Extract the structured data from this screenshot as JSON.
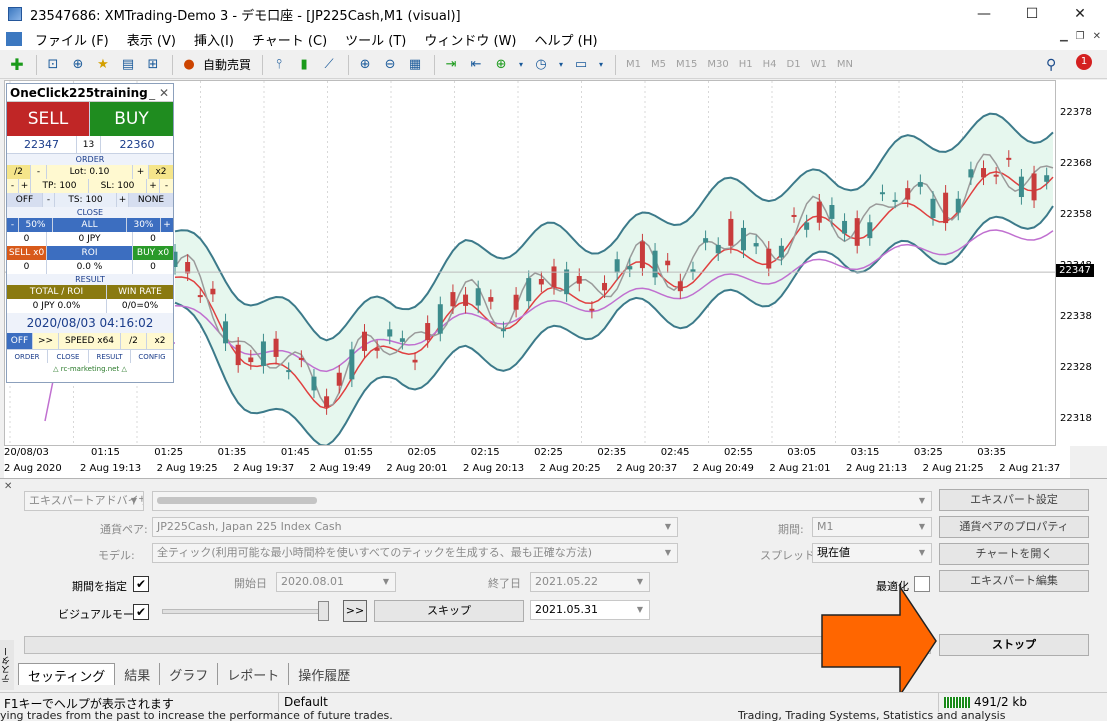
{
  "window": {
    "title": "23547686: XMTrading-Demo 3 - デモ口座 - [JP225Cash,M1 (visual)]",
    "minimize": "—",
    "maximize": "☐",
    "close": "✕"
  },
  "menu": [
    "ファイル (F)",
    "表示 (V)",
    "挿入(I)",
    "チャート (C)",
    "ツール (T)",
    "ウィンドウ (W)",
    "ヘルプ (H)"
  ],
  "toolbar": {
    "auto_trade": "自動売買",
    "timeframes": [
      "M1",
      "M5",
      "M15",
      "M30",
      "H1",
      "H4",
      "D1",
      "W1",
      "MN"
    ],
    "notification_count": "1"
  },
  "chart": {
    "price_labels": [
      "22378",
      "22368",
      "22358",
      "22348",
      "22338",
      "22328",
      "22318"
    ],
    "current_price": "22347",
    "time_labels_top": [
      "20/08/03",
      "01:15",
      "01:25",
      "01:35",
      "01:45",
      "01:55",
      "02:05",
      "02:15",
      "02:25",
      "02:35",
      "02:45",
      "02:55",
      "03:05",
      "03:15",
      "03:25",
      "03:35"
    ],
    "time_labels_bottom": [
      "2 Aug 2020",
      "2 Aug 19:13",
      "2 Aug 19:25",
      "2 Aug 19:37",
      "2 Aug 19:49",
      "2 Aug 20:01",
      "2 Aug 20:13",
      "2 Aug 20:25",
      "2 Aug 20:37",
      "2 Aug 20:49",
      "2 Aug 21:01",
      "2 Aug 21:13",
      "2 Aug 21:25",
      "2 Aug 21:37"
    ],
    "colors": {
      "bull": "#3d8c8c",
      "bear": "#c83c3c",
      "band": "#3c7a8a",
      "ma_fast": "#e04040",
      "ma_slow": "#c070d0",
      "ma_grey": "#9a9a9a"
    }
  },
  "panel": {
    "title": "OneClick225training",
    "sell": "SELL",
    "buy": "BUY",
    "bid": "22347",
    "spread": "13",
    "ask": "22360",
    "order_label": "ORDER",
    "div2": "/2",
    "lot": "Lot: 0.10",
    "plus": "+",
    "x2": "x2",
    "minus": "-",
    "tp": "TP: 100",
    "sl": "SL: 100",
    "off": "OFF",
    "ts": "TS: 100",
    "none": "NONE",
    "close_label": "CLOSE",
    "p50": "50%",
    "all": "ALL",
    "p30": "30%",
    "zero": "0",
    "zero_jpy": "0 JPY",
    "sell_x0": "SELL x0",
    "roi": "ROI",
    "buy_x0": "BUY x0",
    "roi_val": "0.0 %",
    "result_label": "RESULT",
    "total_roi": "TOTAL / ROI",
    "win_rate": "WIN RATE",
    "total_val": "0 JPY 0.0%",
    "win_val": "0/0=0%",
    "datetime": "2020/08/03   04:16:02",
    "ctl_off": "OFF",
    "ctl_ff": ">>",
    "speed": "SPEED x64",
    "tabs": [
      "ORDER",
      "CLOSE",
      "RESULT",
      "CONFIG"
    ],
    "footer": "△ rc-marketing.net △"
  },
  "tester": {
    "expert_type": "エキスパートアドバイザ",
    "expert_name": "",
    "symbol_label": "通貨ペア:",
    "symbol": "JP225Cash, Japan 225 Index Cash",
    "model_label": "モデル:",
    "model": "全ティック(利用可能な最小時間枠を使いすべてのティックを生成する、最も正確な方法)",
    "period_label": "期間:",
    "period": "M1",
    "spread_label": "スプレッド:",
    "spread": "現在値",
    "use_date": "期間を指定",
    "start_label": "開始日",
    "start_date": "2020.08.01",
    "end_label": "終了日",
    "end_date": "2021.05.22",
    "visual_label": "ビジュアルモード",
    "skip_btn": "スキップ",
    "skip_date": "2021.05.31",
    "optimize": "最適化",
    "btn_expert_settings": "エキスパート設定",
    "btn_symbol_props": "通貨ペアのプロパティ",
    "btn_open_chart": "チャートを開く",
    "btn_edit_expert": "エキスパート編集",
    "btn_stop": "ストップ",
    "ff_btn": ">>",
    "tabs": [
      "セッティング",
      "結果",
      "グラフ",
      "レポート",
      "操作履歴"
    ],
    "side_label": "テスター"
  },
  "status": {
    "help": "F1キーでヘルプが表示されます",
    "profile": "Default",
    "traffic": "491/2 kb"
  },
  "bottom": {
    "left": "ying trades from the past to increase the performance of future trades.",
    "right": "Trading, Trading Systems, Statistics and analysis"
  }
}
